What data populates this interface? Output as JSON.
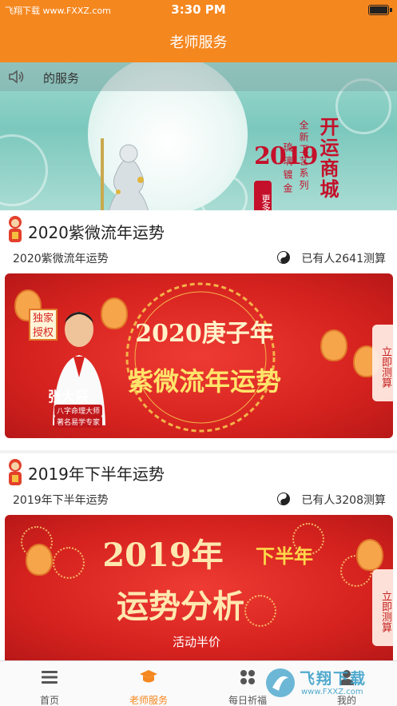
{
  "status_bar": {
    "carrier": "飞翔下载 www.FXXZ.com",
    "time": "3:30 PM"
  },
  "nav": {
    "title": "老师服务"
  },
  "banner": {
    "notice_text": "的服务",
    "year_text": "2019",
    "badge_text": "更多精品",
    "big_text": "开运商城",
    "small_text_1": "全新工艺系列",
    "small_text_2": "琉璃镀金"
  },
  "cards": [
    {
      "title": "2020紫微流年运势",
      "subtitle": "2020紫微流年运势",
      "count": "已有人2641测算",
      "promo": {
        "line1": "2020庚子年",
        "line2": "紫微流年运势",
        "badge": "独家授权",
        "teacher_name": "张大辰",
        "teacher_title_1": "八字命理大师",
        "teacher_title_2": "著名易学专家",
        "side_button": "立即测算"
      }
    },
    {
      "title": "2019年下半年运势",
      "subtitle": "2019年下半年运势",
      "count": "已有人3208测算",
      "promo": {
        "line1": "2019年",
        "line1b": "下半年",
        "line2": "运势分析",
        "line3": "活动半价",
        "side_button": "立即测算"
      }
    }
  ],
  "tabs": [
    {
      "label": "首页",
      "icon": "menu-icon",
      "active": false
    },
    {
      "label": "老师服务",
      "icon": "graduation-cap-icon",
      "active": true
    },
    {
      "label": "每日祈福",
      "icon": "grid-icon",
      "active": false
    },
    {
      "label": "我的",
      "icon": "user-icon",
      "active": false
    }
  ],
  "watermark": {
    "brand": "飞翔下载",
    "url": "www.FXXZ.com"
  },
  "colors": {
    "brand_orange": "#f5871f",
    "promo_red": "#d7231f",
    "banner_teal": "#9fd9cf"
  }
}
